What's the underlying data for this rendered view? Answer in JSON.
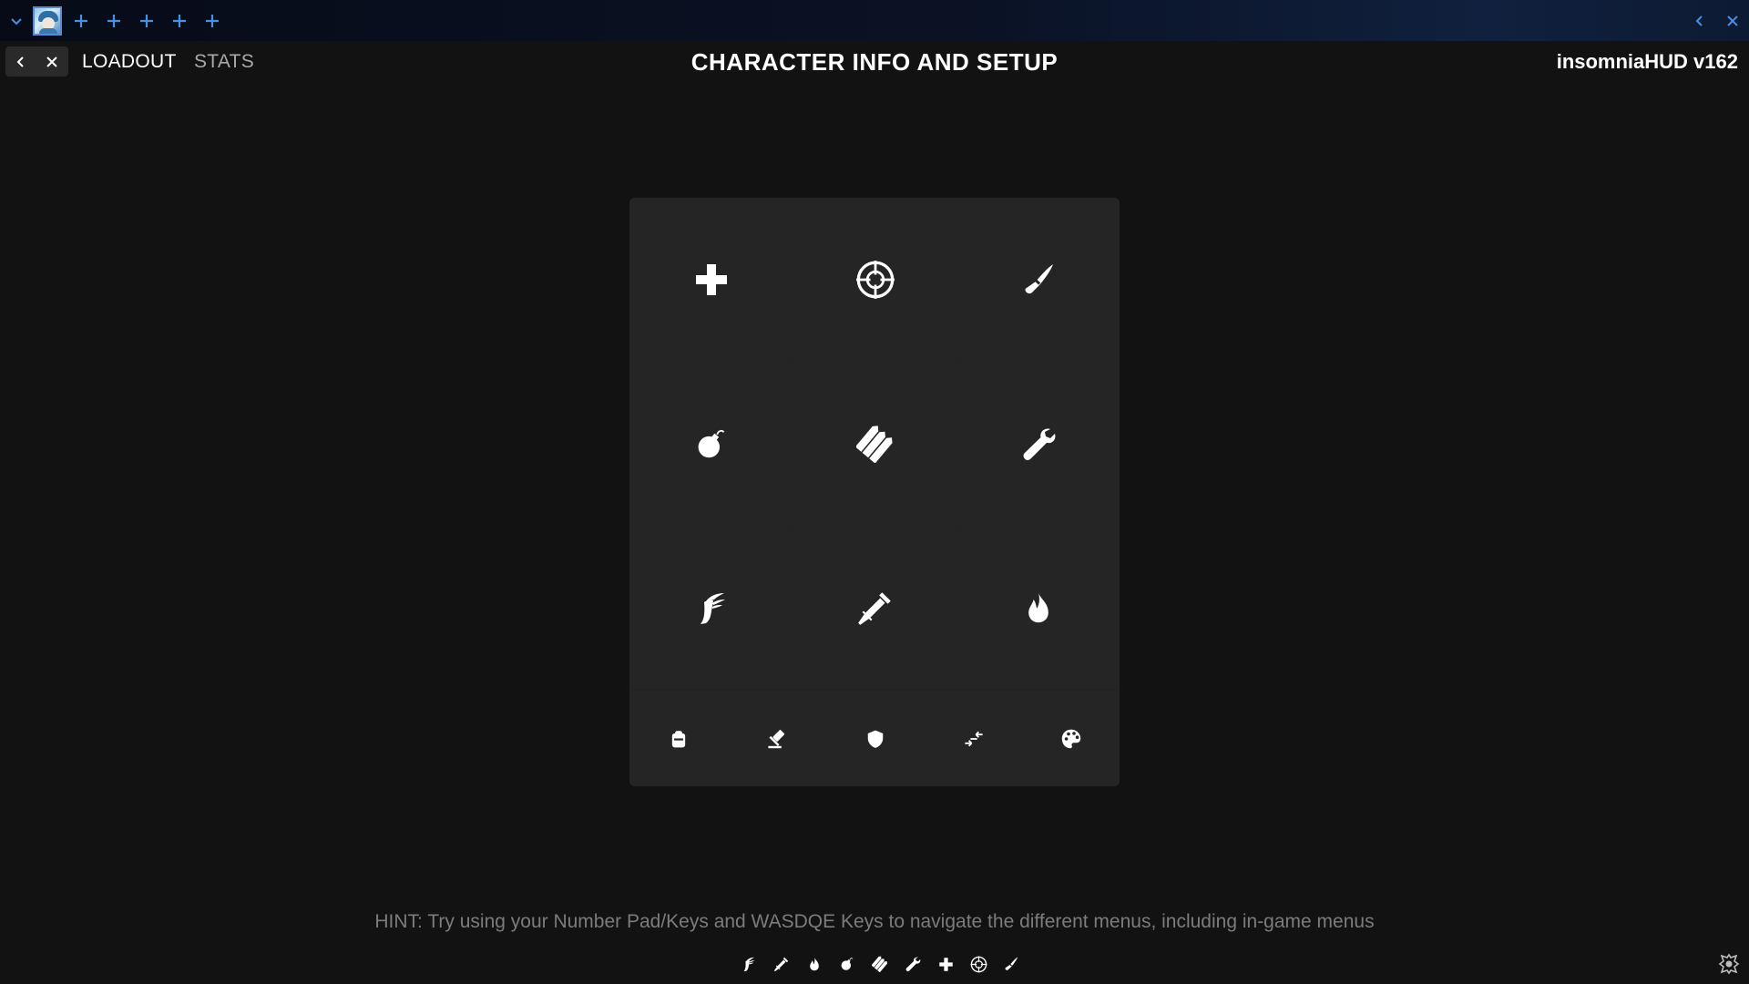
{
  "topbar": {
    "icons": [
      "chevron-down-icon",
      "avatar",
      "plus-icon",
      "plus-icon",
      "plus-icon",
      "plus-icon",
      "plus-icon",
      "chevron-left-icon",
      "close-icon"
    ],
    "accent_color": "#4a90e2"
  },
  "header": {
    "tabs": [
      {
        "label": "LOADOUT",
        "active": true
      },
      {
        "label": "STATS",
        "active": false
      }
    ],
    "title": "CHARACTER INFO AND SETUP",
    "version": "insomniaHUD v162"
  },
  "grid": {
    "cells": [
      {
        "icon": "medic-cross-icon"
      },
      {
        "icon": "crosshair-icon"
      },
      {
        "icon": "knife-icon"
      },
      {
        "icon": "bomb-icon"
      },
      {
        "icon": "ammo-icon"
      },
      {
        "icon": "wrench-icon"
      },
      {
        "icon": "winged-boot-icon"
      },
      {
        "icon": "syringe-icon"
      },
      {
        "icon": "fire-icon"
      }
    ],
    "bottom_row": [
      {
        "icon": "backpack-icon"
      },
      {
        "icon": "hammer-icon"
      },
      {
        "icon": "shield-icon"
      },
      {
        "icon": "swap-arrows-icon"
      },
      {
        "icon": "palette-icon"
      }
    ]
  },
  "hint": "HINT: Try using your Number Pad/Keys and WASDQE Keys to navigate the different menus, including in-game menus",
  "dock": {
    "icons": [
      "winged-boot-icon",
      "syringe-icon",
      "fire-icon",
      "bomb-icon",
      "ammo-icon",
      "wrench-icon",
      "medic-cross-icon",
      "crosshair-icon",
      "knife-icon"
    ]
  },
  "corner_logo": "emblem-icon"
}
